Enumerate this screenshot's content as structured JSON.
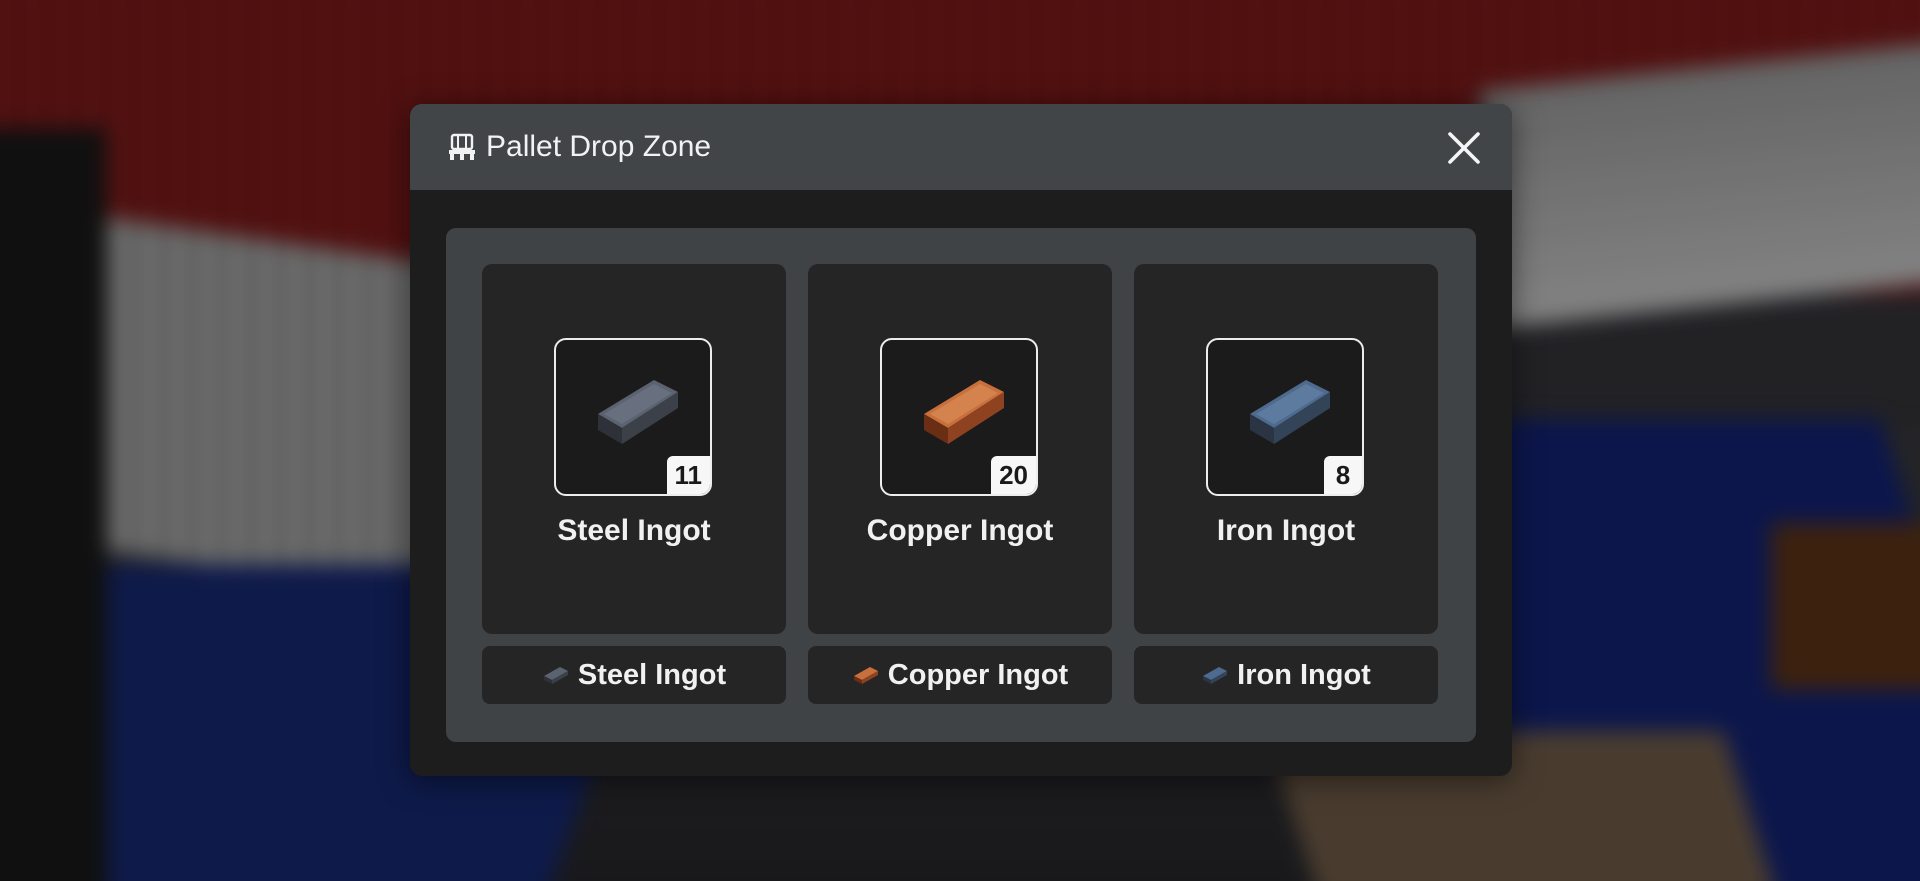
{
  "dialog": {
    "title": "Pallet Drop Zone",
    "header_icon": "pallet-icon",
    "close_icon": "close-icon"
  },
  "slots": [
    {
      "name": "Steel Ingot",
      "quantity": "11",
      "icon": "steel-ingot-icon",
      "color": "#4a4f58"
    },
    {
      "name": "Copper Ingot",
      "quantity": "20",
      "icon": "copper-ingot-icon",
      "color": "#b0582c"
    },
    {
      "name": "Iron Ingot",
      "quantity": "8",
      "icon": "iron-ingot-icon",
      "color": "#3e5470"
    }
  ],
  "filters": [
    {
      "label": "Steel Ingot",
      "icon": "steel-ingot-icon"
    },
    {
      "label": "Copper Ingot",
      "icon": "copper-ingot-icon"
    },
    {
      "label": "Iron Ingot",
      "icon": "iron-ingot-icon"
    }
  ],
  "colors": {
    "header_bg": "#414548",
    "dialog_bg": "#1d1d1e",
    "panel_bg": "#3f4346",
    "card_bg": "#252526"
  }
}
